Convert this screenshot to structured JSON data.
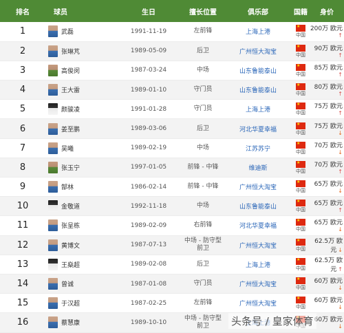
{
  "headers": {
    "rank": "排名",
    "player": "球员",
    "birth": "生日",
    "position": "擅长位置",
    "club": "俱乐部",
    "nationality": "国籍",
    "value": "身价"
  },
  "rows": [
    {
      "rank": "1",
      "name": "武磊",
      "birth": "1991-11-19",
      "pos": "左前锋",
      "club": "上海上港",
      "nat": "中国",
      "value": "200万 欧元",
      "trend": "up",
      "trend_glyph": "↑"
    },
    {
      "rank": "2",
      "name": "张琳芃",
      "birth": "1989-05-09",
      "pos": "后卫",
      "club": "广州恒大淘宝",
      "nat": "中国",
      "value": "90万 欧元",
      "trend": "up",
      "trend_glyph": "↑"
    },
    {
      "rank": "3",
      "name": "高俊闵",
      "birth": "1987-03-24",
      "pos": "中场",
      "club": "山东鲁能泰山",
      "nat": "中国",
      "value": "85万 欧元",
      "trend": "up",
      "trend_glyph": "↑"
    },
    {
      "rank": "4",
      "name": "王大雷",
      "birth": "1989-01-10",
      "pos": "守门员",
      "club": "山东鲁能泰山",
      "nat": "中国",
      "value": "80万 欧元",
      "trend": "up",
      "trend_glyph": "↑"
    },
    {
      "rank": "5",
      "name": "颜骏凌",
      "birth": "1991-01-28",
      "pos": "守门员",
      "club": "上海上港",
      "nat": "中国",
      "value": "75万 欧元",
      "trend": "up",
      "trend_glyph": "↑"
    },
    {
      "rank": "6",
      "name": "姜至鹏",
      "birth": "1989-03-06",
      "pos": "后卫",
      "club": "河北华夏幸福",
      "nat": "中国",
      "value": "75万 欧元",
      "trend": "down",
      "trend_glyph": "↓"
    },
    {
      "rank": "7",
      "name": "吴曦",
      "birth": "1989-02-19",
      "pos": "中场",
      "club": "江苏苏宁",
      "nat": "中国",
      "value": "70万 欧元",
      "trend": "down",
      "trend_glyph": "↓"
    },
    {
      "rank": "8",
      "name": "张玉宁",
      "birth": "1997-01-05",
      "pos": "前锋 - 中锋",
      "club": "维迪斯",
      "nat": "中国",
      "value": "70万 欧元",
      "trend": "up",
      "trend_glyph": "↑"
    },
    {
      "rank": "9",
      "name": "郜林",
      "birth": "1986-02-14",
      "pos": "前锋 - 中锋",
      "club": "广州恒大淘宝",
      "nat": "中国",
      "value": "65万 欧元",
      "trend": "down",
      "trend_glyph": "↓"
    },
    {
      "rank": "10",
      "name": "金敬道",
      "birth": "1992-11-18",
      "pos": "中场",
      "club": "山东鲁能泰山",
      "nat": "中国",
      "value": "65万 欧元",
      "trend": "up",
      "trend_glyph": "↑"
    },
    {
      "rank": "11",
      "name": "张呈栋",
      "birth": "1989-02-09",
      "pos": "右前锋",
      "club": "河北华夏幸福",
      "nat": "中国",
      "value": "65万 欧元",
      "trend": "down",
      "trend_glyph": "↓"
    },
    {
      "rank": "12",
      "name": "黄博文",
      "birth": "1987-07-13",
      "pos": "中场 - 防守型前卫",
      "club": "广州恒大淘宝",
      "nat": "中国",
      "value": "62.5万 欧元",
      "trend": "down",
      "trend_glyph": "↓"
    },
    {
      "rank": "13",
      "name": "王燊超",
      "birth": "1989-02-08",
      "pos": "后卫",
      "club": "上海上港",
      "nat": "中国",
      "value": "62.5万 欧元",
      "trend": "up",
      "trend_glyph": "↑"
    },
    {
      "rank": "14",
      "name": "曾诚",
      "birth": "1987-01-08",
      "pos": "守门员",
      "club": "广州恒大淘宝",
      "nat": "中国",
      "value": "60万 欧元",
      "trend": "down",
      "trend_glyph": "↓"
    },
    {
      "rank": "15",
      "name": "于汉超",
      "birth": "1987-02-25",
      "pos": "左前锋",
      "club": "广州恒大淘宝",
      "nat": "中国",
      "value": "60万 欧元",
      "trend": "down",
      "trend_glyph": "↓"
    },
    {
      "rank": "16",
      "name": "蔡慧康",
      "birth": "1989-10-10",
      "pos": "中场 - 防守型前卫",
      "club": "上海上港",
      "nat": "中国",
      "value": "60万 欧元",
      "trend": "down",
      "trend_glyph": "↓"
    }
  ],
  "watermark": "头条号 / 皇家体育",
  "colors": {
    "header_bg": "#4f8a35",
    "club_link": "#2a66b8",
    "flag_red": "#de2910",
    "trend_up": "#d9534f",
    "trend_down": "#e36a20"
  }
}
